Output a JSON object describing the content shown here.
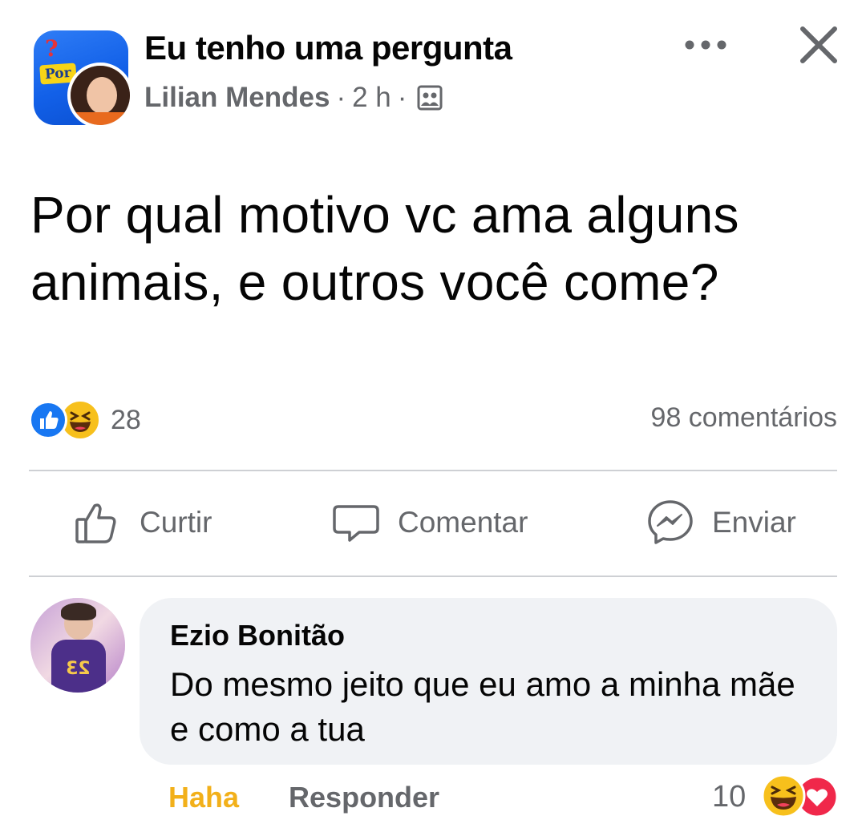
{
  "header": {
    "group_name": "Eu tenho uma pergunta",
    "group_avatar_text": "Por",
    "author": "Lilian Mendes",
    "time": "2 h",
    "separator": "·",
    "audience_icon": "group-audience-icon",
    "more_icon": "more-options-icon",
    "close_icon": "close-icon"
  },
  "post": {
    "text": "Por qual motivo vc ama alguns animais, e outros você come?"
  },
  "stats": {
    "reaction_icons": [
      "like-icon",
      "haha-icon"
    ],
    "reaction_count": "28",
    "comments": "98 comentários"
  },
  "actions": {
    "like_label": "Curtir",
    "comment_label": "Comentar",
    "share_label": "Enviar"
  },
  "comment": {
    "author": "Ezio Bonitão",
    "text": "Do mesmo jeito que eu amo a minha mãe e como a tua",
    "reaction_label": "Haha",
    "reply_label": "Responder",
    "reaction_count": "10",
    "reaction_icons": [
      "haha-icon",
      "love-icon"
    ]
  },
  "colors": {
    "like_blue": "#1877f2",
    "haha_yellow": "#f2b01a",
    "love_red": "#f0284a",
    "secondary_text": "#65676b",
    "bubble_bg": "#f0f2f5"
  }
}
